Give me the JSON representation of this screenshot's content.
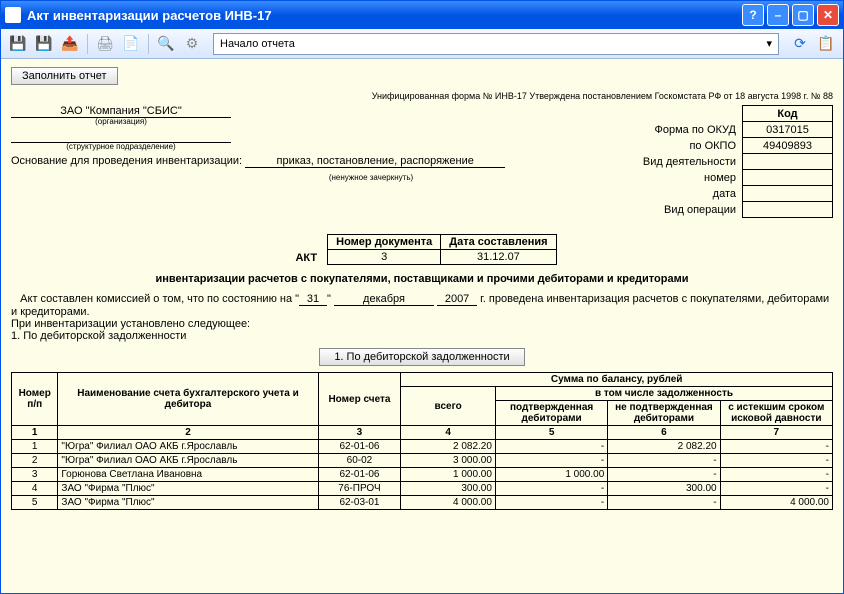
{
  "window": {
    "title": "Акт инвентаризации расчетов ИНВ-17"
  },
  "toolbar": {
    "address": "Начало отчета"
  },
  "buttons": {
    "fill_report": "Заполнить отчет",
    "tab1": "1. По дебиторской задолженности"
  },
  "header": {
    "approval": "Унифицированная форма № ИНВ-17 Утверждена постановлением Госкомстата РФ от 18 августа 1998 г. № 88",
    "code_header": "Код",
    "okud_label": "Форма по ОКУД",
    "okud": "0317015",
    "okpo_label": "по ОКПО",
    "okpo": "49409893",
    "org_name": "ЗАО \"Компания \"СБИС\"",
    "org_sub": "(организация)",
    "subdiv_sub": "(структурное подразделение)",
    "activity_label": "Вид деятельности",
    "basis_label": "Основание для проведения инвентаризации:",
    "basis_value": "приказ, постановление, распоряжение",
    "basis_sub": "(ненужное зачеркнуть)",
    "number_label": "номер",
    "date_label": "дата",
    "op_label": "Вид операции"
  },
  "doc_meta": {
    "doc_num_header": "Номер документа",
    "doc_date_header": "Дата составления",
    "doc_num": "3",
    "doc_date": "31.12.07",
    "akt": "АКТ",
    "subtitle": "инвентаризации расчетов с покупателями, поставщиками и прочими дебиторами и кредиторами"
  },
  "body": {
    "line1_pre": "Акт составлен комиссией о том, что по состоянию на \"",
    "day": "31",
    "mid": "\"",
    "month": "декабря",
    "year": "2007",
    "line1_post": "г. проведена инвентаризация расчетов с покупателями, дебиторами и кредиторами.",
    "line2": "При инвентаризации установлено следующее:",
    "line3": "1. По дебиторской задолженности"
  },
  "table": {
    "h_num": "Номер п/п",
    "h_name": "Наименование счета бухгалтерского учета и дебитора",
    "h_acc": "Номер счета",
    "h_balance": "Сумма по балансу, рублей",
    "h_total": "всего",
    "h_sub": "в том числе задолженность",
    "h_confirmed": "подтвержденная дебиторами",
    "h_unconfirmed": "не подтвержденная дебиторами",
    "h_expired": "с истекшим сроком исковой давности",
    "cols": [
      "1",
      "2",
      "3",
      "4",
      "5",
      "6",
      "7"
    ],
    "rows": [
      {
        "n": "1",
        "name": "\"Югра\" Филиал ОАО АКБ г.Ярославль",
        "acc": "62-01-06",
        "total": "2 082.20",
        "c1": "-",
        "c2": "2 082.20",
        "c3": "-"
      },
      {
        "n": "2",
        "name": "\"Югра\" Филиал ОАО АКБ г.Ярославль",
        "acc": "60-02",
        "total": "3 000.00",
        "c1": "-",
        "c2": "-",
        "c3": "-"
      },
      {
        "n": "3",
        "name": "Горюнова Светлана Ивановна",
        "acc": "62-01-06",
        "total": "1 000.00",
        "c1": "1 000.00",
        "c2": "-",
        "c3": "-"
      },
      {
        "n": "4",
        "name": "ЗАО \"Фирма \"Плюс\"",
        "acc": "76-ПРОЧ",
        "total": "300.00",
        "c1": "-",
        "c2": "300.00",
        "c3": "-"
      },
      {
        "n": "5",
        "name": "ЗАО \"Фирма \"Плюс\"",
        "acc": "62-03-01",
        "total": "4 000.00",
        "c1": "-",
        "c2": "-",
        "c3": "4 000.00"
      }
    ]
  }
}
